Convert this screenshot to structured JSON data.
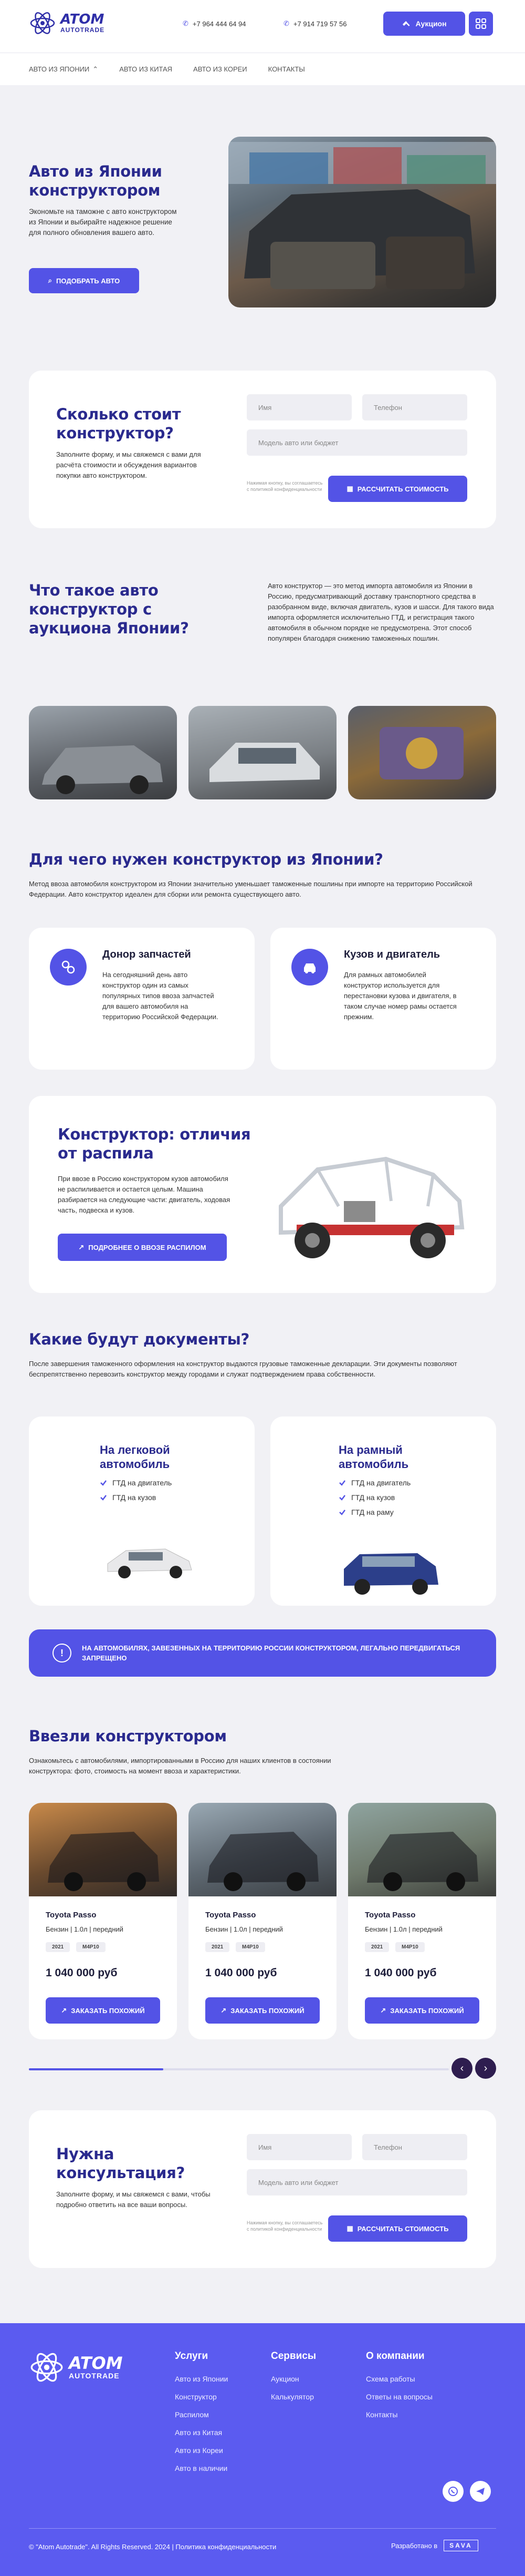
{
  "header": {
    "logo_name": "ATOM",
    "logo_sub": "AUTOTRADE",
    "phone1": "+7 964 444 64 94",
    "phone2": "+7 914 719 57 56",
    "auction_label": "Аукцион"
  },
  "nav": [
    "АВТО ИЗ ЯПОНИИ",
    "АВТО ИЗ КИТАЯ",
    "АВТО ИЗ КОРЕИ",
    "КОНТАКТЫ"
  ],
  "hero": {
    "title": "Авто из Японии конструктором",
    "text": "Экономьте на таможне с авто конструктором из Японии и выбирайте надежное решение для полного обновления вашего авто.",
    "button": "ПОДОБРАТЬ АВТО"
  },
  "cost_form": {
    "title": "Сколько стоит конструктор?",
    "text": "Заполните форму, и мы свяжемся с вами для расчёта стоимости и обсуждения вариантов покупки авто конструктором.",
    "name_placeholder": "Имя",
    "phone_placeholder": "Телефон",
    "model_placeholder": "Модель авто или бюджет",
    "consent": "Нажимая кнопку, вы соглашаетесь с политикой конфиденциальности",
    "button": "РАССЧИТАТЬ СТОИМОСТЬ"
  },
  "what": {
    "title": "Что такое авто конструктор с аукциона Японии?",
    "text": "Авто конструктор — это метод импорта автомобиля из Японии в Россию, предусматривающий доставку транспортного средства в разобранном виде, включая двигатель, кузов и шасси. Для такого вида импорта оформляется исключительно ГТД, и регистрация такого автомобиля в обычном порядке не предусмотрена. Этот способ популярен благодаря снижению таможенных пошлин."
  },
  "why": {
    "title": "Для чего нужен конструктор из Японии?",
    "text": "Метод ввоза автомобиля конструктором из Японии значительно уменьшает таможенные пошлины при импорте на территорию Российской Федерации. Авто конструктор идеален для сборки или ремонта существующего авто.",
    "cards": [
      {
        "title": "Донор запчастей",
        "text": "На сегодняшний день авто конструктор один из самых популярных типов ввоза запчастей для вашего автомобиля на территорию Российской Федерации."
      },
      {
        "title": "Кузов и двигатель",
        "text": "Для рамных автомобилей конструктор используется для перестановки кузова и двигателя, в таком случае номер рамы остается прежним."
      }
    ]
  },
  "diff": {
    "title": "Конструктор: отличия от распила",
    "text": "При ввозе в Россию конструктором кузов автомобиля не распиливается и остается целым. Машина разбирается на следующие части: двигатель, ходовая часть, подвеска и кузов.",
    "button": "ПОДРОБНЕЕ О ВВОЗЕ РАСПИЛОМ"
  },
  "docs": {
    "title": "Какие будут документы?",
    "text": "После завершения таможенного оформления на конструктор выдаются грузовые таможенные декларации. Эти документы позволяют беспрепятственно перевозить конструктор между городами и служат подтверждением права собственности.",
    "cards": [
      {
        "title": "На легковой автомобиль",
        "items": [
          "ГТД на двигатель",
          "ГТД на кузов"
        ]
      },
      {
        "title": "На рамный автомобиль",
        "items": [
          "ГТД на двигатель",
          "ГТД на кузов",
          "ГТД на раму"
        ]
      }
    ],
    "warning": "НА АВТОМОБИЛЯХ, ЗАВЕЗЕННЫХ НА ТЕРРИТОРИЮ РОССИИ КОНСТРУКТОРОМ, ЛЕГАЛЬНО ПЕРЕДВИГАТЬСЯ ЗАПРЕЩЕНО"
  },
  "imported": {
    "title": "Ввезли конструктором",
    "text": "Ознакомьтесь с автомобилями, импортированными в Россию для наших клиентов в состоянии конструктора: фото, стоимость на момент ввоза и характеристики.",
    "cars": [
      {
        "name": "Toyota Passo",
        "spec": "Бензин | 1.0л | передний",
        "year": "2021",
        "code": "M4P10",
        "price": "1 040 000 руб",
        "button": "ЗАКАЗАТЬ ПОХОЖИЙ"
      },
      {
        "name": "Toyota Passo",
        "spec": "Бензин | 1.0л | передний",
        "year": "2021",
        "code": "M4P10",
        "price": "1 040 000 руб",
        "button": "ЗАКАЗАТЬ ПОХОЖИЙ"
      },
      {
        "name": "Toyota Passo",
        "spec": "Бензин | 1.0л | передний",
        "year": "2021",
        "code": "M4P10",
        "price": "1 040 000 руб",
        "button": "ЗАКАЗАТЬ ПОХОЖИЙ"
      }
    ]
  },
  "consult": {
    "title": "Нужна консультация?",
    "text": "Заполните форму, и мы свяжемся с вами, чтобы подробно ответить на все ваши вопросы.",
    "name_placeholder": "Имя",
    "phone_placeholder": "Телефон",
    "model_placeholder": "Модель авто или бюджет",
    "consent": "Нажимая кнопку, вы соглашаетесь с политикой конфиденциальности",
    "button": "РАССЧИТАТЬ СТОИМОСТЬ"
  },
  "footer": {
    "col1_title": "Услуги",
    "col1": [
      "Авто из Японии",
      "Конструктор",
      "Распилом",
      "Авто из Китая",
      "Авто из Кореи",
      "Авто в наличии"
    ],
    "col2_title": "Сервисы",
    "col2": [
      "Аукцион",
      "Калькулятор"
    ],
    "col3_title": "О компании",
    "col3": [
      "Схема работы",
      "Ответы на вопросы",
      "Контакты"
    ],
    "copyright": "© \"Atom Autotrade\". All Rights Reserved. 2024 | Политика конфиденциальности",
    "dev_label": "Разработано в",
    "dev_brand": "SAVA"
  },
  "colors": {
    "accent": "#5353e6",
    "title": "#2a2a8e",
    "footer_bg": "#5b5bf0"
  }
}
